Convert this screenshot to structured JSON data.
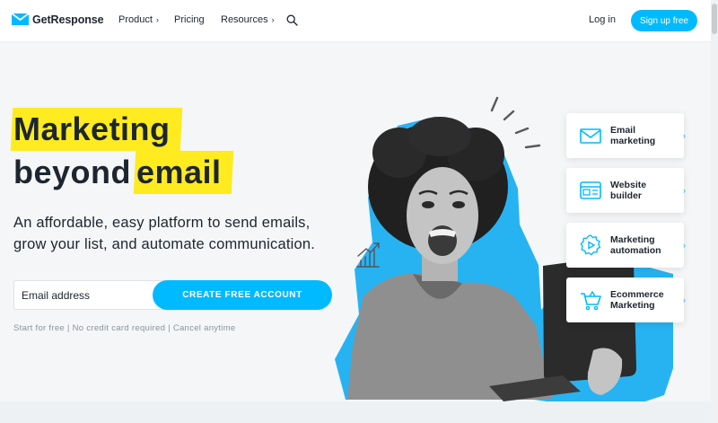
{
  "nav": {
    "logo_text": "GetResponse",
    "items": [
      {
        "label": "Product",
        "chevron": "›"
      },
      {
        "label": "Pricing"
      },
      {
        "label": "Resources",
        "chevron": "›"
      }
    ],
    "search_icon": "search-icon",
    "login_label": "Log in",
    "signup_label": "Sign up free"
  },
  "hero": {
    "headline_line1_marked": "Marketing",
    "headline_line2_plain": "beyond",
    "headline_line2_marked": "email",
    "subtext": "An affordable, easy platform to send emails, grow your list, and automate communication.",
    "email_placeholder": "Email address",
    "cta_label": "CREATE FREE ACCOUNT",
    "fine_print": "Start for free | No credit card required | Cancel anytime"
  },
  "features": [
    {
      "label": "Email marketing",
      "icon": "envelope-icon"
    },
    {
      "label": "Website builder",
      "icon": "website-icon"
    },
    {
      "label": "Marketing automation",
      "icon": "gear-play-icon"
    },
    {
      "label": "Ecommerce Marketing",
      "icon": "cart-icon"
    }
  ],
  "colors": {
    "accent": "#00baff",
    "highlight": "#ffeb1f",
    "text": "#1d262f",
    "muted": "#8a949c"
  }
}
